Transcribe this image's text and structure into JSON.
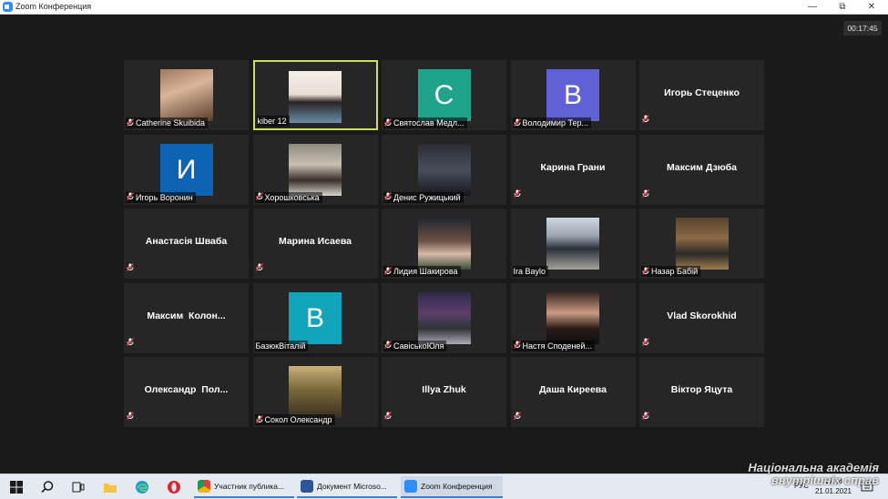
{
  "window": {
    "title": "Zoom Конференция"
  },
  "meeting": {
    "timer": "00:17:45"
  },
  "participants": [
    {
      "name": "Catherine Skuibida",
      "video": "photo-woman-curly-hair",
      "muted": true
    },
    {
      "name": "kiber 12",
      "video": "photo-woman-dark-hair",
      "muted": false,
      "active": true
    },
    {
      "name": "Святослав Медл...",
      "avatar": "С",
      "avatar_color": "#1fa38a",
      "muted": true
    },
    {
      "name": "Володимир Тер...",
      "avatar": "В",
      "avatar_color": "#6161d6",
      "muted": true
    },
    {
      "name": "Игорь Стеценко",
      "muted": true
    },
    {
      "name": "Игорь Воронин",
      "avatar": "И",
      "avatar_color": "#0e64b4",
      "muted": true
    },
    {
      "name": "Хорошковська",
      "video": "photo-girl-room",
      "muted": true
    },
    {
      "name": "Денис Ружицький",
      "video": "photo-dark-room",
      "muted": true
    },
    {
      "name": "Карина Грани",
      "muted": true
    },
    {
      "name": "Максим Дзюба",
      "muted": true
    },
    {
      "name": "Анастасія Шваба",
      "muted": true
    },
    {
      "name": "Марина Исаева",
      "muted": true
    },
    {
      "name": "Лидия Шакирова",
      "video": "photo-woman-police-cap",
      "muted": true
    },
    {
      "name": "Ira Baylo",
      "video": "photo-woman-street",
      "muted": false
    },
    {
      "name": "Назар Бабій",
      "video": "photo-man-autumn",
      "muted": true
    },
    {
      "name": "Максим  Колон...",
      "muted": true
    },
    {
      "name": "БазюкВіталій",
      "avatar": "В",
      "avatar_color": "#12a4ba",
      "muted": false
    },
    {
      "name": "СавіськоЮля",
      "video": "photo-woman-christmas-tree",
      "muted": true
    },
    {
      "name": "Настя Споденей...",
      "video": "photo-girl-portrait",
      "muted": true
    },
    {
      "name": "Vlad Skorokhid",
      "muted": true
    },
    {
      "name": "Олександр  Пол...",
      "muted": true
    },
    {
      "name": "Сокол Олександр",
      "video": "photo-man-sunset",
      "muted": true
    },
    {
      "name": "Illya Zhuk",
      "muted": true
    },
    {
      "name": "Даша Киреева",
      "muted": true
    },
    {
      "name": "Віктор Яцута",
      "muted": true
    }
  ],
  "taskbar": {
    "apps": [
      {
        "label": "Участник публика...",
        "icon": "chrome-icon"
      },
      {
        "label": "Документ Microso...",
        "icon": "word-icon"
      },
      {
        "label": "Zoom Конференция",
        "icon": "zoom-icon"
      }
    ],
    "tray": {
      "lang": "РУС",
      "time": "15:18",
      "date": "21.01.2021"
    }
  },
  "watermark": {
    "line1": "Національна академія",
    "line2": "внутрішніх справ"
  },
  "colors": {
    "active_border": "#c8e35b",
    "muted_icon": "#e0383e",
    "tile_bg": "#262626"
  }
}
